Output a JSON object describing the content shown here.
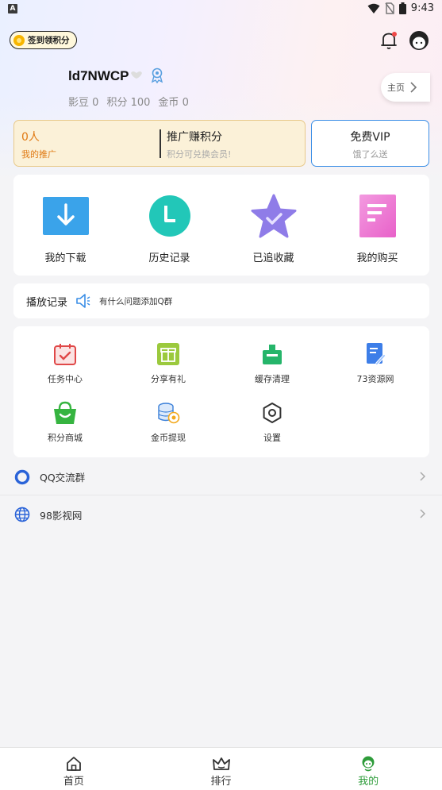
{
  "status_bar": {
    "left_icon": "A",
    "time": "9:43"
  },
  "header": {
    "signin_label": "签到领积分"
  },
  "profile": {
    "username": "ld7NWCP",
    "stats": [
      {
        "label": "影豆",
        "value": "0"
      },
      {
        "label": "积分",
        "value": "100"
      },
      {
        "label": "金币",
        "value": "0"
      }
    ],
    "home_label": "主页"
  },
  "promo": {
    "count": "0人",
    "my_promo": "我的推广",
    "earn_title": "推广赚积分",
    "earn_sub": "积分可兑换会员!",
    "vip_title": "免费VIP",
    "vip_sub": "饿了么送"
  },
  "quick_actions": [
    {
      "label": "我的下载",
      "icon": "download-icon"
    },
    {
      "label": "历史记录",
      "icon": "history-icon"
    },
    {
      "label": "已追收藏",
      "icon": "favorite-star-icon"
    },
    {
      "label": "我的购买",
      "icon": "purchase-icon"
    }
  ],
  "play_record": {
    "title": "播放记录",
    "tip": "有什么问题添加Q群"
  },
  "tools": [
    {
      "label": "任务中心",
      "icon": "task-center-icon"
    },
    {
      "label": "分享有礼",
      "icon": "gift-icon"
    },
    {
      "label": "缓存清理",
      "icon": "cache-clean-icon"
    },
    {
      "label": "73资源网",
      "icon": "resource-doc-icon"
    },
    {
      "label": "积分商城",
      "icon": "points-shop-icon"
    },
    {
      "label": "金币提现",
      "icon": "coin-withdraw-icon"
    },
    {
      "label": "设置",
      "icon": "settings-icon"
    }
  ],
  "links": [
    {
      "label": "QQ交流群",
      "icon": "qq-ring-icon"
    },
    {
      "label": "98影视网",
      "icon": "globe-icon"
    }
  ],
  "bottom_nav": [
    {
      "label": "首页",
      "icon": "home-icon"
    },
    {
      "label": "排行",
      "icon": "crown-icon"
    },
    {
      "label": "我的",
      "icon": "profile-icon",
      "active": true
    }
  ],
  "colors": {
    "accent_green": "#2e9c3a",
    "promo_orange": "#e07a14",
    "vip_border": "#3a8ee6"
  }
}
